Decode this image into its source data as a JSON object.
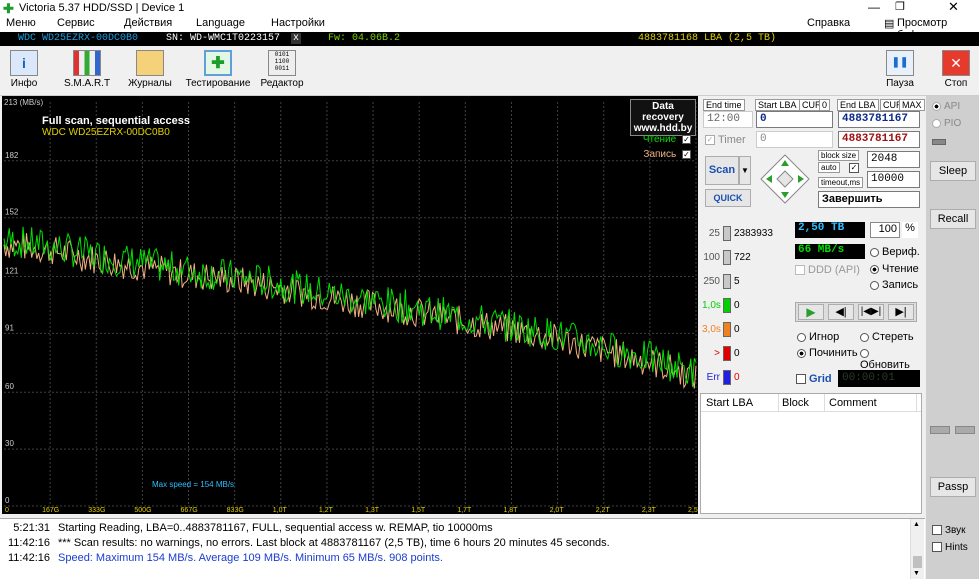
{
  "window": {
    "title": "Victoria 5.37 HDD/SSD | Device 1"
  },
  "menu": {
    "items": [
      "Меню",
      "Сервис",
      "Действия",
      "Language",
      "Настройки"
    ],
    "right": [
      "Справка",
      "Просмотр буфера"
    ]
  },
  "device": {
    "model": "WDC WD25EZRX-00DC0B0",
    "sn": "SN: WD-WMC1T0223157",
    "x": "x",
    "fw": "Fw: 04.06B.2",
    "lba": "4883781168 LBA (2,5 TB)"
  },
  "toolbar": {
    "items": [
      "Инфо",
      "S.M.A.R.T",
      "Журналы",
      "Тестирование",
      "Редактор"
    ],
    "pause": "Пауза",
    "stop": "Стоп"
  },
  "graph": {
    "ylabel": "213 (MB/s)",
    "yticks": [
      "182",
      "152",
      "121",
      "91",
      "60",
      "30",
      "0"
    ],
    "xticks": [
      "167G",
      "333G",
      "500G",
      "667G",
      "833G",
      "1,0T",
      "1,2T",
      "1,3T",
      "1,5T",
      "1,7T",
      "1,8T",
      "2,0T",
      "2,2T",
      "2,3T",
      "2,5T"
    ],
    "title": "Full scan, sequential access",
    "model": "WDC WD25EZRX-00DC0B0",
    "promo1": "Data recovery",
    "promo2": "www.hdd.by",
    "legend_read": "Чтение",
    "legend_write": "Запись",
    "max_speed": "Max speed = 154 MB/s",
    "colors": {
      "read": "#00e000",
      "write": "#f0b080",
      "grid": "#404040"
    }
  },
  "chart_data": {
    "type": "line",
    "title": "Full scan, sequential access",
    "ylabel": "(MB/s)",
    "ylim": [
      0,
      213
    ],
    "x": [
      "0",
      "167G",
      "333G",
      "500G",
      "667G",
      "833G",
      "1,0T",
      "1,2T",
      "1,3T",
      "1,5T",
      "1,7T",
      "1,8T",
      "2,0T",
      "2,2T",
      "2,3T",
      "2,5T"
    ],
    "series": [
      {
        "name": "Чтение",
        "values": [
          140,
          137,
          132,
          128,
          124,
          121,
          117,
          112,
          108,
          104,
          99,
          95,
          90,
          84,
          78,
          70
        ]
      }
    ]
  },
  "controls": {
    "end_time_lbl": "End time",
    "start_lba_lbl": "Start LBA",
    "cur": "CUR",
    "zero": "0",
    "end_lba_lbl": "End LBA",
    "max": "MAX",
    "time_val": "12:00",
    "start_val": "0",
    "end_val": "4883781167",
    "end_val2": "4883781167",
    "timer_lbl": "Timer",
    "timer_val": "0",
    "scan": "Scan",
    "quick": "QUICK",
    "block_size_lbl": "block size",
    "auto_lbl": "auto",
    "timeout_lbl": "timeout,ms",
    "block_size": "2048",
    "timeout": "10000",
    "finish": "Завершить"
  },
  "stats": {
    "rows": [
      {
        "label": "25",
        "count": "2383933",
        "color": "#c8c8c8"
      },
      {
        "label": "100",
        "count": "722",
        "color": "#c8c8c8"
      },
      {
        "label": "250",
        "count": "5",
        "color": "#c8c8c8"
      },
      {
        "label": "1,0s",
        "count": "0",
        "color": "#00d000"
      },
      {
        "label": "3,0s",
        "count": "0",
        "color": "#f08020"
      },
      {
        "label": ">",
        "count": "0",
        "color": "#e00000"
      },
      {
        "label": "Err",
        "count": "0",
        "color": "#2020e0"
      }
    ],
    "size": "2,50 TB",
    "percent": "100",
    "percent_sign": "%",
    "speed": "66 MB/s",
    "ddd": "DDD (API)",
    "verify": "Вериф.",
    "read": "Чтение",
    "write": "Запись",
    "ignore": "Игнор",
    "erase": "Стереть",
    "repair": "Починить",
    "refresh": "Обновить",
    "grid": "Grid",
    "elapsed": "00:00:01"
  },
  "table": {
    "headers": [
      "Start LBA",
      "Block",
      "Comment"
    ]
  },
  "sidebar": {
    "api": "API",
    "pio": "PIO",
    "sleep": "Sleep",
    "recall": "Recall",
    "passp": "Passp",
    "sound": "Звук",
    "hints": "Hints"
  },
  "log": [
    {
      "time": "5:21:31",
      "msg": "Starting Reading, LBA=0..4883781167, FULL, sequential access w. REMAP, tio 10000ms",
      "color": "#000000"
    },
    {
      "time": "11:42:16",
      "msg": "*** Scan results: no warnings, no errors. Last block at 4883781167 (2,5 TB), time 6 hours 20 minutes 45 seconds.",
      "color": "#000000"
    },
    {
      "time": "11:42:16",
      "msg": "Speed: Maximum 154 MB/s. Average 109 MB/s. Minimum 65 MB/s. 908 points.",
      "color": "#1a3cd0"
    }
  ]
}
